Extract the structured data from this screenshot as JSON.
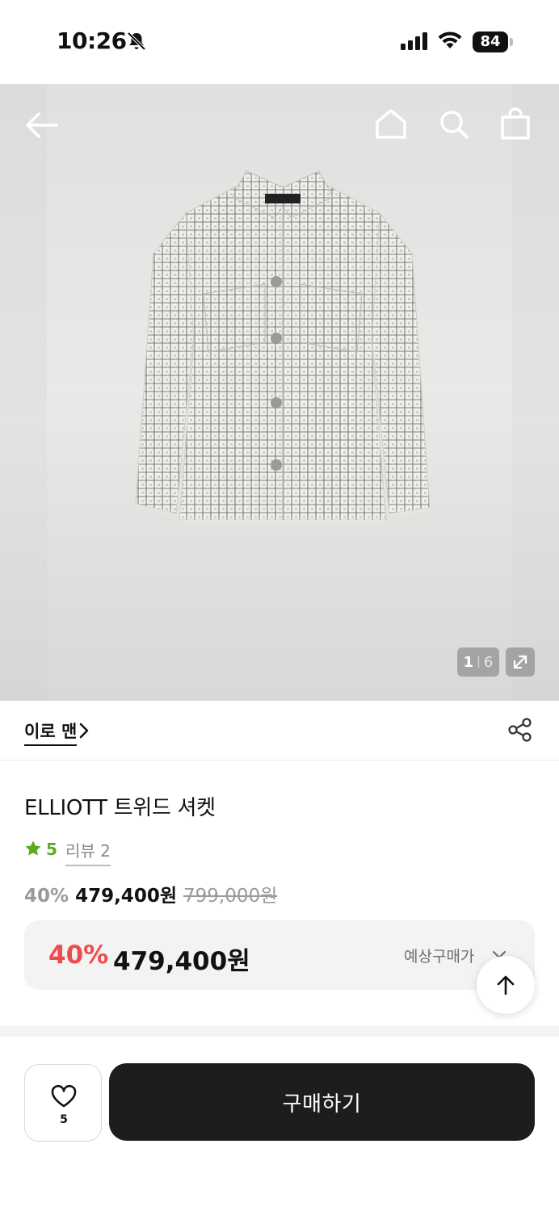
{
  "status_bar": {
    "time": "10:26",
    "battery": "84",
    "icons": [
      "bell-slash-icon",
      "signal-icon",
      "wifi-icon",
      "battery-icon"
    ]
  },
  "header": {
    "icons": [
      "back-arrow-icon",
      "home-icon",
      "search-icon",
      "shopping-bag-icon"
    ]
  },
  "gallery": {
    "current": "1",
    "separator": "|",
    "total": "6",
    "expand_icon": "expand-icon"
  },
  "brand": {
    "name": "이로 맨",
    "chevron": "›",
    "share_icon": "share-icon"
  },
  "product": {
    "title": "ELLIOTT 트위드 셔켓",
    "rating": "5",
    "review_label": "리뷰 2",
    "discount": "40%",
    "sale_price": "479,400원",
    "original_price": "799,000원"
  },
  "expected_price": {
    "discount": "40%",
    "price": "479,400원",
    "label": "예상구매가"
  },
  "bottom_bar": {
    "like_count": "5",
    "buy_label": "구매하기"
  },
  "colors": {
    "accent_red": "#f04b4b",
    "rating_green": "#5aac1e",
    "buy_button": "#1d1d1d"
  }
}
